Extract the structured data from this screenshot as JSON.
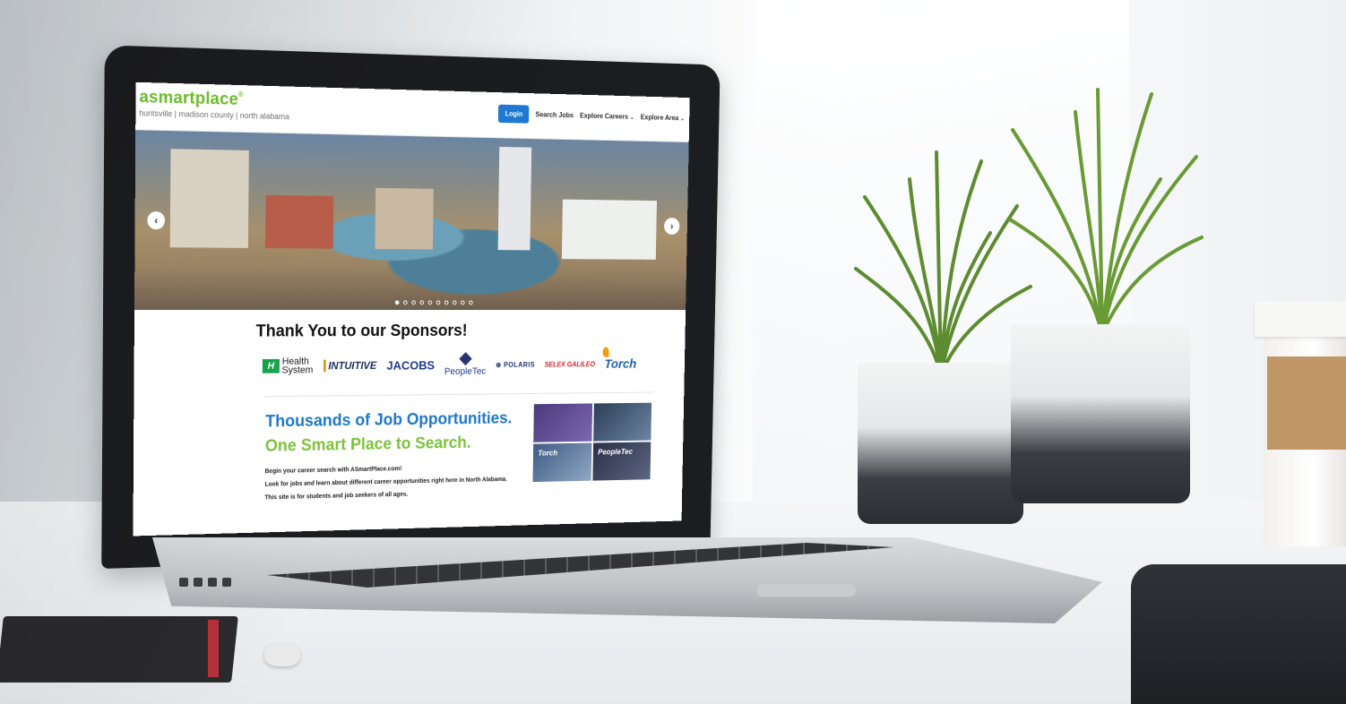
{
  "site": {
    "logo": {
      "main": "asmartplace",
      "reg": "®",
      "tagline": "huntsville | madison county | north alabama"
    },
    "nav": {
      "login": "Login",
      "search_jobs": "Search Jobs",
      "explore_careers": "Explore Careers",
      "explore_area": "Explore Area"
    },
    "carousel": {
      "prev": "‹",
      "next": "›",
      "slide_count": 10,
      "active_index": 0
    },
    "sponsors": {
      "title": "Thank You to our Sponsors!",
      "logos": {
        "health_mark": "H",
        "health_top": "Health",
        "health_bottom": "System",
        "intuitive": "INTUITIVE",
        "jacobs": "JACOBS",
        "peopletec": "PeopleTec",
        "polaris": "POLARIS",
        "selex": "SELEX GALILEO",
        "torch": "Torch"
      }
    },
    "jobs": {
      "headline": "Thousands of Job Opportunities.",
      "subheadline": "One Smart Place to Search.",
      "line1": "Begin your career search with ASmartPlace.com!",
      "line2": "Look for jobs and learn about different career opportunities right here in North Alabama.",
      "line3": "This site is for students and job seekers of all ages.",
      "collage_brands": [
        "Torch",
        "PeopleTec"
      ]
    }
  },
  "colors": {
    "brand_green": "#6cbb2b",
    "brand_blue": "#1f78c8",
    "login_button": "#1f78d1"
  }
}
